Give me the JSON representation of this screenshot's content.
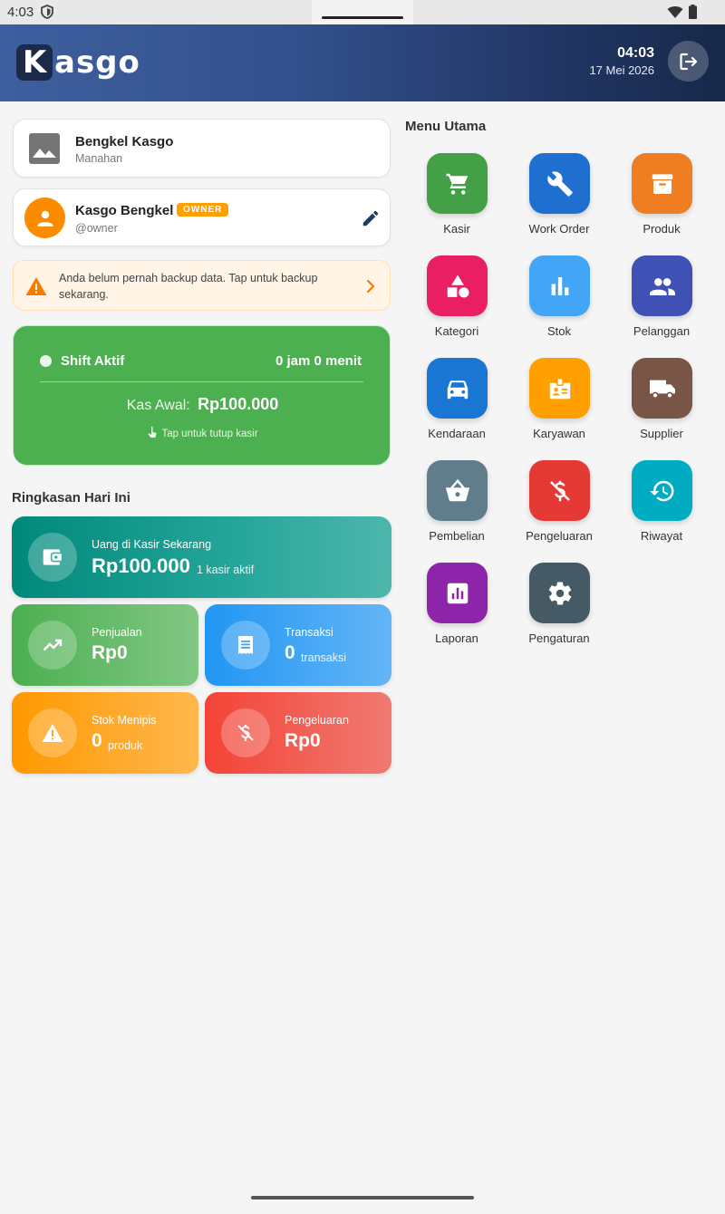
{
  "status_bar": {
    "time": "4:03"
  },
  "header": {
    "logo_k": "K",
    "logo_rest": "asgo",
    "time": "04:03",
    "date": "17 Mei 2026"
  },
  "shop": {
    "name": "Bengkel Kasgo",
    "location": "Manahan"
  },
  "user": {
    "name": "Kasgo Bengkel",
    "badge": "OWNER",
    "handle": "@owner"
  },
  "backup_banner": {
    "text": "Anda belum pernah backup data. Tap untuk backup sekarang."
  },
  "shift": {
    "title": "Shift Aktif",
    "duration": "0 jam 0 menit",
    "kas_label": "Kas Awal:",
    "kas_value": "Rp100.000",
    "hint": "Tap untuk tutup kasir"
  },
  "summary": {
    "title": "Ringkasan Hari Ini",
    "cash": {
      "label": "Uang di Kasir Sekarang",
      "value": "Rp100.000",
      "sub": "1 kasir aktif"
    },
    "sales": {
      "label": "Penjualan",
      "value": "Rp0"
    },
    "transactions": {
      "label": "Transaksi",
      "value": "0",
      "sub": "transaksi"
    },
    "low_stock": {
      "label": "Stok Menipis",
      "value": "0",
      "sub": "produk"
    },
    "expenses": {
      "label": "Pengeluaran",
      "value": "Rp0"
    }
  },
  "menu": {
    "title": "Menu Utama",
    "items": [
      {
        "label": "Kasir",
        "icon": "cart-icon",
        "color": "#43a047"
      },
      {
        "label": "Work Order",
        "icon": "wrench-icon",
        "color": "#1e6fd0"
      },
      {
        "label": "Produk",
        "icon": "archive-icon",
        "color": "#ef7d22"
      },
      {
        "label": "Kategori",
        "icon": "category-icon",
        "color": "#e91e63"
      },
      {
        "label": "Stok",
        "icon": "bar-chart-icon",
        "color": "#42a5f5"
      },
      {
        "label": "Pelanggan",
        "icon": "people-icon",
        "color": "#3f51b5"
      },
      {
        "label": "Kendaraan",
        "icon": "car-icon",
        "color": "#1976d2"
      },
      {
        "label": "Karyawan",
        "icon": "badge-icon",
        "color": "#ffa000"
      },
      {
        "label": "Supplier",
        "icon": "truck-icon",
        "color": "#795548"
      },
      {
        "label": "Pembelian",
        "icon": "basket-icon",
        "color": "#607d8b"
      },
      {
        "label": "Pengeluaran",
        "icon": "money-off-icon",
        "color": "#e53935"
      },
      {
        "label": "Riwayat",
        "icon": "history-icon",
        "color": "#00acc1"
      },
      {
        "label": "Laporan",
        "icon": "report-icon",
        "color": "#8e24aa"
      },
      {
        "label": "Pengaturan",
        "icon": "gear-icon",
        "color": "#455a64"
      }
    ]
  }
}
